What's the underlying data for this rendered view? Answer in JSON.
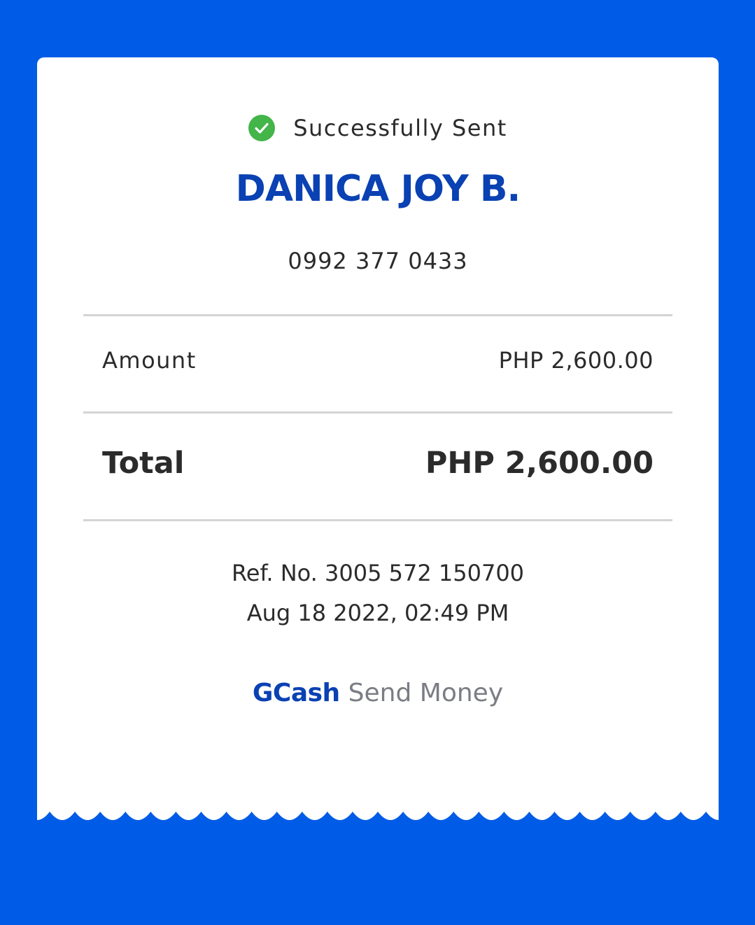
{
  "colors": {
    "background": "#005ce6",
    "receipt": "#ffffff",
    "accent": "#0a41b3",
    "success": "#43b549",
    "text": "#2b2b2b",
    "muted": "#7a7d83",
    "divider": "#d4d4d4"
  },
  "status": {
    "icon": "check-circle-icon",
    "text": "Successfully Sent"
  },
  "recipient": {
    "name": "DANICA JOY B.",
    "number": "0992 377 0433"
  },
  "amount": {
    "label": "Amount",
    "value": "PHP 2,600.00"
  },
  "total": {
    "label": "Total",
    "value": "PHP 2,600.00"
  },
  "reference": {
    "ref_no": "Ref. No. 3005 572 150700",
    "datetime": "Aug 18 2022, 02:49 PM"
  },
  "footer": {
    "brand": "GCash",
    "service": "Send Money"
  }
}
